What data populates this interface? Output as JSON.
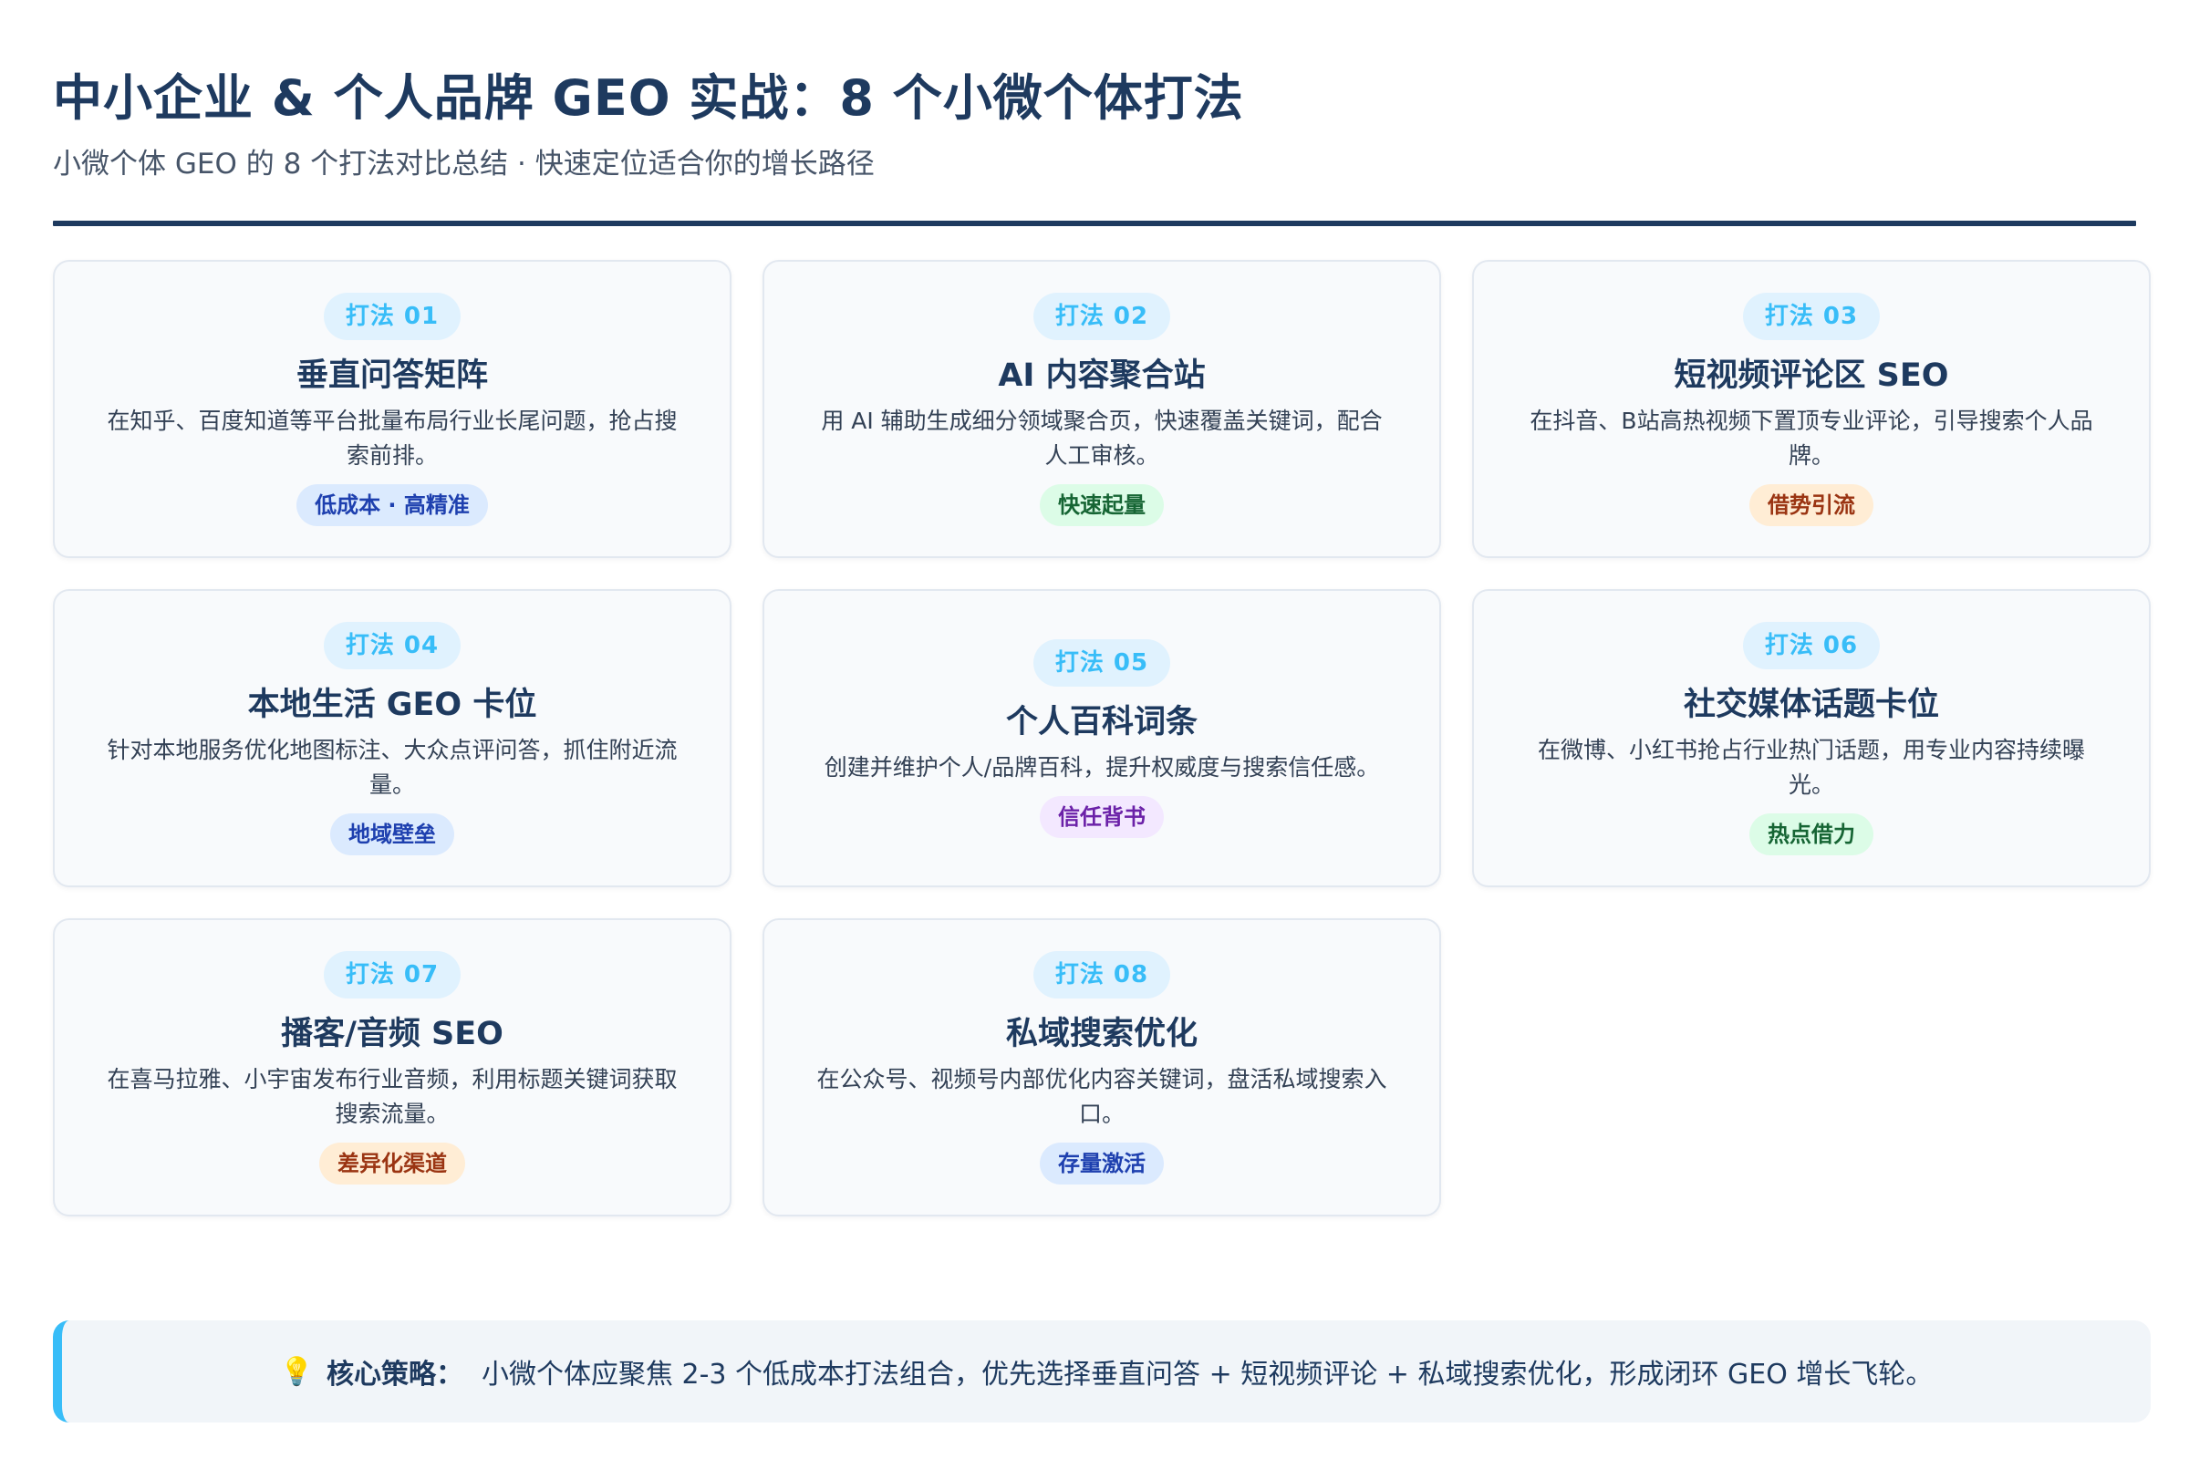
{
  "header": {
    "title": "中小企业 & 个人品牌 GEO 实战：8 个小微个体打法",
    "subtitle": "小微个体 GEO 的 8 个打法对比总结 · 快速定位适合你的增长路径"
  },
  "cards": [
    {
      "badge": "打法 01",
      "title": "垂直问答矩阵",
      "desc": "在知乎、百度知道等平台批量布局行业长尾问题，抢占搜索前排。",
      "tag": "低成本 · 高精准",
      "tag_color": "blue"
    },
    {
      "badge": "打法 02",
      "title": "AI 内容聚合站",
      "desc": "用 AI 辅助生成细分领域聚合页，快速覆盖关键词，配合人工审核。",
      "tag": "快速起量",
      "tag_color": "green"
    },
    {
      "badge": "打法 03",
      "title": "短视频评论区 SEO",
      "desc": "在抖音、B站高热视频下置顶专业评论，引导搜索个人品牌。",
      "tag": "借势引流",
      "tag_color": "orange"
    },
    {
      "badge": "打法 04",
      "title": "本地生活 GEO 卡位",
      "desc": "针对本地服务优化地图标注、大众点评问答，抓住附近流量。",
      "tag": "地域壁垒",
      "tag_color": "blue"
    },
    {
      "badge": "打法 05",
      "title": "个人百科词条",
      "desc": "创建并维护个人/品牌百科，提升权威度与搜索信任感。",
      "tag": "信任背书",
      "tag_color": "purple"
    },
    {
      "badge": "打法 06",
      "title": "社交媒体话题卡位",
      "desc": "在微博、小红书抢占行业热门话题，用专业内容持续曝光。",
      "tag": "热点借力",
      "tag_color": "green"
    },
    {
      "badge": "打法 07",
      "title": "播客/音频 SEO",
      "desc": "在喜马拉雅、小宇宙发布行业音频，利用标题关键词获取搜索流量。",
      "tag": "差异化渠道",
      "tag_color": "orange"
    },
    {
      "badge": "打法 08",
      "title": "私域搜索优化",
      "desc": "在公众号、视频号内部优化内容关键词，盘活私域搜索入口。",
      "tag": "存量激活",
      "tag_color": "blue"
    }
  ],
  "strategy": {
    "icon": "lightbulb-icon",
    "label": "核心策略：",
    "text": "小微个体应聚焦 2-3 个低成本打法组合，优先选择垂直问答 + 短视频评论 + 私域搜索优化，形成闭环 GEO 增长飞轮。"
  },
  "colors": {
    "primary": "#1e3a5f",
    "accent": "#38bdf8",
    "badge_bg": "#e0f2fe",
    "card_bg": "#f8fafc",
    "tag_blue": "#1e40af",
    "tag_green": "#166534",
    "tag_orange": "#9a3412",
    "tag_purple": "#6b21a8"
  }
}
